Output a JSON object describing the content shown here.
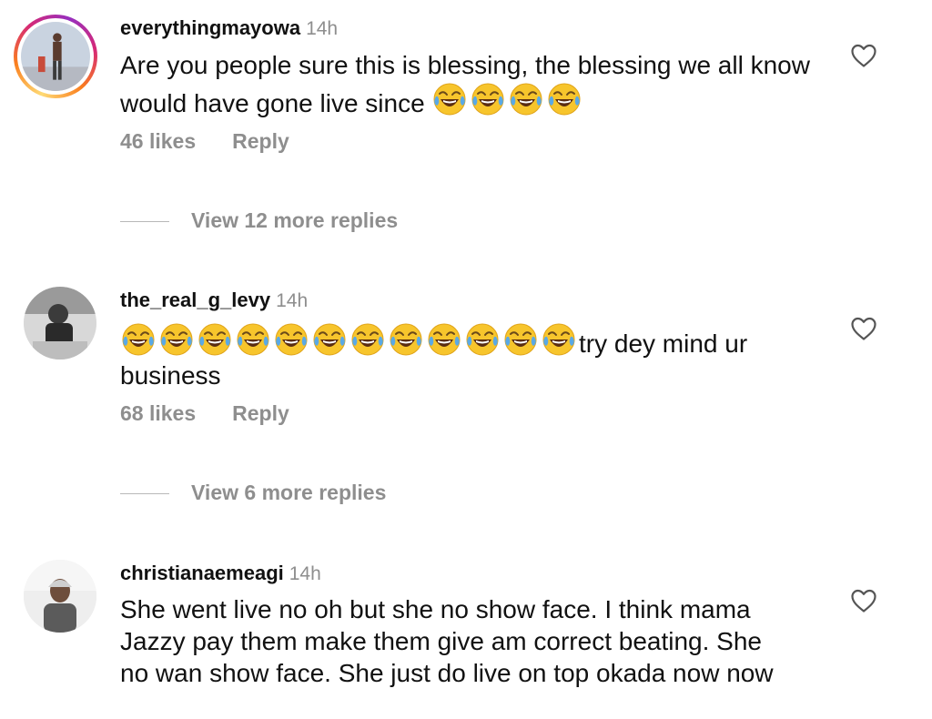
{
  "comments": [
    {
      "username": "everythingmayowa",
      "time": "14h",
      "text_before": "Are you people sure this is blessing, the blessing we all know would have gone live since",
      "emoji_count_before": 0,
      "emoji_count_after": 4,
      "likes": "46 likes",
      "reply_label": "Reply",
      "view_replies": "View 12 more replies"
    },
    {
      "username": "the_real_g_levy",
      "time": "14h",
      "emoji_count_before": 12,
      "text_after": "try dey mind ur business",
      "likes": "68 likes",
      "reply_label": "Reply",
      "view_replies": "View 6 more replies"
    },
    {
      "username": "christianaemeagi",
      "time": "14h",
      "text_before": "She went live no oh but she no show face. I think mama Jazzy pay them make them give am correct beating. She no wan show face. She just do live on top okada now now"
    }
  ],
  "icons": {
    "emoji": "face-with-tears-of-joy-icon",
    "like": "heart-outline-icon"
  },
  "colors": {
    "meta_gray": "#8e8e8e",
    "text": "#111111"
  }
}
